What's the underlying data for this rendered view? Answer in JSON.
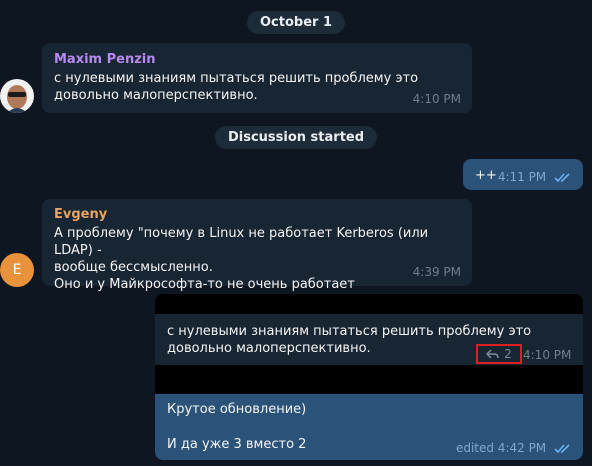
{
  "date_pill": "October 1",
  "msg1": {
    "sender": "Maxim Penzin",
    "sender_color": "#b78af0",
    "text": "с нулевыми знаниям пытаться решить проблему это довольно малоперспективно.",
    "time": "4:10 PM",
    "avatar_icon": "user-photo-avatar"
  },
  "discussion_pill": "Discussion started",
  "msg2": {
    "text": "++",
    "time": "4:11 PM",
    "status_icon": "double-check-icon"
  },
  "msg3": {
    "sender": "Evgeny",
    "sender_color": "#e8a361",
    "avatar_letter": "E",
    "avatar_color": "#e8923c",
    "lines": [
      "А проблему \"почему в Linux  не работает Kerberos (или LDAP) -",
      "вообще бессмысленно.",
      "Оно и у Майкрософта-то не очень работает"
    ],
    "time": "4:39 PM"
  },
  "forwarded": {
    "text": "с нулевыми знаниям пытаться решить проблему это довольно малоперспективно.",
    "reply_count": "2",
    "time": "4:10 PM"
  },
  "msg4": {
    "line1": "Крутое обновление)",
    "line2": "И да уже 3 вместо 2",
    "time": "edited 4:42 PM",
    "bubble_color": "#2b5278"
  },
  "colors": {
    "background": "#0e1621",
    "incoming": "#182533",
    "outgoing": "#2b5278",
    "check": "#6bb2f0",
    "highlight": "#e02020"
  }
}
